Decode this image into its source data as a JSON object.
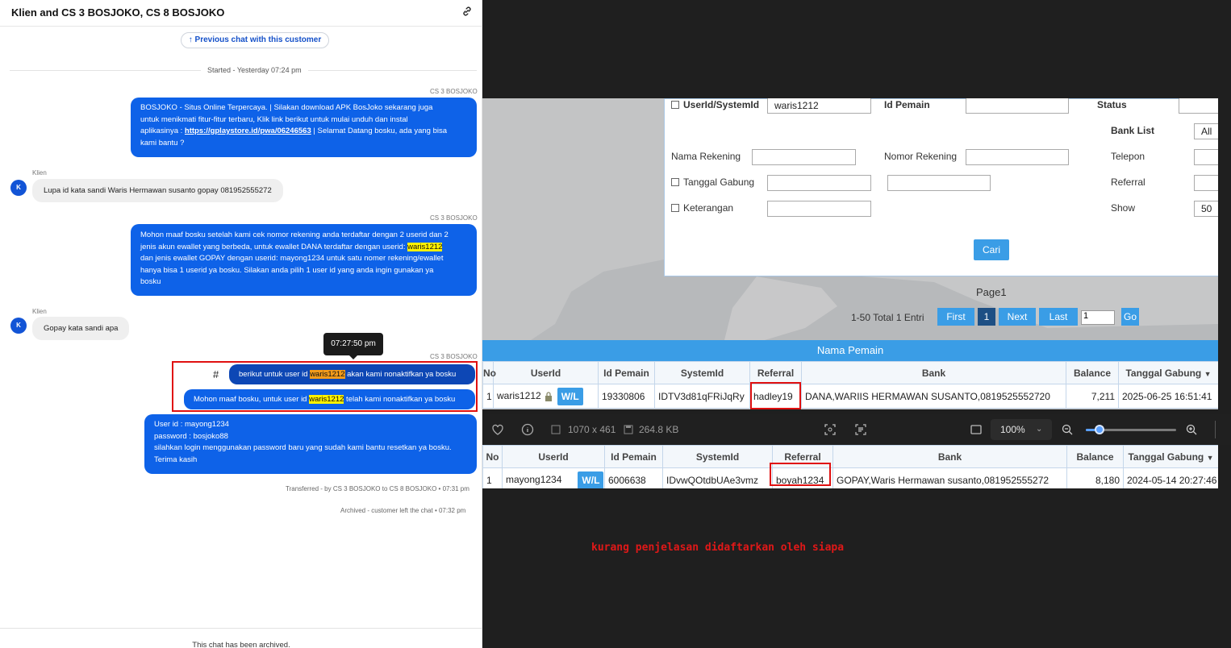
{
  "chat": {
    "title": "Klien and CS 3 BOSJOKO, CS 8 BOSJOKO",
    "prev_chat_label": "Previous chat with this customer",
    "started_label": "Started - Yesterday 07:24 pm",
    "messages": [
      {
        "sender": "CS 3 BOSJOKO",
        "lines": [
          "BOSJOKO - Situs Online Terpercaya. | Silakan download APK BosJoko sekarang juga",
          "untuk menikmati fitur-fitur terbaru, Klik link berikut untuk mulai unduh dan instal"
        ],
        "line3_prefix": "aplikasinya : ",
        "line3_link": "https://gplaystore.id/pwa/06246563",
        "line3_suffix": " | Selamat Datang bosku, ada yang bisa",
        "line4": "kami bantu ?"
      },
      {
        "sender": "Klien",
        "avatar": "K",
        "text": "Lupa id kata sandi Waris Hermawan susanto gopay 081952555272"
      },
      {
        "sender": "CS 3 BOSJOKO",
        "line1": "Mohon maaf bosku setelah kami cek nomor rekening anda terdaftar dengan 2 userid dan 2",
        "line2_prefix": "jenis akun ewallet yang berbeda, untuk ewallet DANA terdaftar dengan userid: ",
        "line2_hl": "waris1212",
        "line3": "dan jenis ewallet GOPAY dengan userid: mayong1234 untuk satu nomer rekening/ewallet",
        "line4": "hanya bisa 1 userid ya bosku. Silakan anda pilih 1 user id yang anda ingin gunakan ya",
        "line5": "bosku"
      },
      {
        "sender": "Klien",
        "avatar": "K",
        "text": "Gopay kata sandi apa"
      },
      {
        "sender": "CS 3 BOSJOKO",
        "tooltip": "07:27:50 pm",
        "hash": "#",
        "a_prefix": "berikut untuk user id ",
        "a_hl": "waris1212",
        "a_suffix": " akan kami nonaktifkan ya bosku",
        "b_prefix": "Mohon maaf bosku, untuk user id ",
        "b_hl": "waris1212",
        "b_suffix": " telah kami nonaktifkan ya bosku"
      },
      {
        "lines": [
          "User id : mayong1234",
          "password : bosjoko88",
          "silahkan login menggunakan password baru yang sudah kami bantu resetkan ya bosku.",
          "Terima kasih"
        ]
      }
    ],
    "transferred_note": "Transferred - by CS 3 BOSJOKO to CS 8 BOSJOKO • 07:31 pm",
    "archived_note": "Archived - customer left the chat • 07:32 pm",
    "footer": "This chat has been archived."
  },
  "search_form": {
    "userid_label": "UserId/SystemId",
    "userid_value": "waris1212",
    "id_pemain_label": "Id Pemain",
    "status_label": "Status",
    "bank_list_label": "Bank List",
    "bank_list_value": "All",
    "nama_rekening_label": "Nama Rekening",
    "nomor_rekening_label": "Nomor Rekening",
    "telepon_label": "Telepon",
    "tanggal_gabung_label": "Tanggal Gabung",
    "referral_label": "Referral",
    "keterangan_label": "Keterangan",
    "show_label": "Show",
    "show_value": "50",
    "cari_label": "Cari"
  },
  "pagination": {
    "page_label": "Page1",
    "total_label": "1-50 Total 1 Entri",
    "first": "First",
    "current": "1",
    "next": "Next",
    "last": "Last",
    "input_value": "1",
    "go": "Go"
  },
  "table_title": "Nama Pemain",
  "table_headers": [
    "No",
    "UserId",
    "Id Pemain",
    "SystemId",
    "Referral",
    "Bank",
    "Balance",
    "Tanggal Gabung"
  ],
  "row1": {
    "no": "1",
    "userid": "waris1212",
    "wl": "W/L",
    "id_pemain": "19330806",
    "systemid": "IDTV3d81qFRiJqRy",
    "referral": "hadley19",
    "bank": "DANA,WARIIS HERMAWAN SUSANTO,0819525552720",
    "balance": "7,211",
    "tanggal": "2025-06-25 16:51:41"
  },
  "viewer_toolbar": {
    "dimensions": "1070 x 461",
    "file_size": "264.8 KB",
    "zoom": "100%",
    "zoom_slider_level_percent": 15
  },
  "row2": {
    "no": "1",
    "userid": "mayong1234",
    "wl": "W/L",
    "id_pemain": "6006638",
    "systemid": "IDvwQOtdbUAe3vmz",
    "referral": "boyah1234",
    "bank": "GOPAY,Waris Hermawan susanto,081952555272",
    "balance": "8,180",
    "tanggal": "2024-05-14 20:27:46"
  },
  "annotation": "kurang penjelasan didaftarkan oleh siapa",
  "colors": {
    "chat_blue": "#0e62e8",
    "table_blue": "#3a9de6",
    "highlight": "#fff200",
    "alert_red": "#e01010"
  }
}
